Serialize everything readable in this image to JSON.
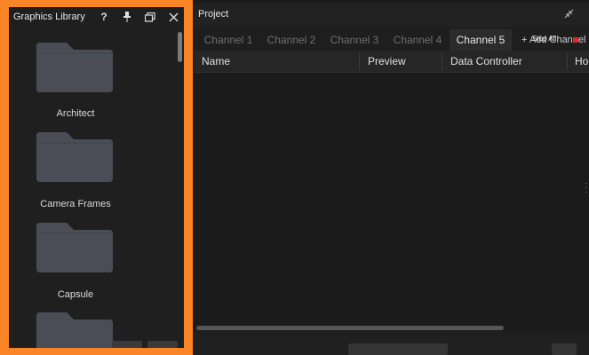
{
  "graphics_library": {
    "title": "Graphics Library",
    "icons": [
      "help-icon",
      "pin-icon",
      "restore-window-icon",
      "close-icon"
    ],
    "help_glyph": "?",
    "folders": [
      {
        "label": "Architect"
      },
      {
        "label": "Camera Frames"
      },
      {
        "label": "Capsule"
      },
      {
        "label": ""
      }
    ]
  },
  "project": {
    "title": "Project",
    "tabs": [
      {
        "label": "Channel 1",
        "active": false
      },
      {
        "label": "Channel 2",
        "active": false
      },
      {
        "label": "Channel 3",
        "active": false
      },
      {
        "label": "Channel 4",
        "active": false
      },
      {
        "label": "Channel 5",
        "active": true
      }
    ],
    "add_channel_label": "+ Add Channel",
    "stop_all_label": "Stop All",
    "columns": [
      "Name",
      "Preview",
      "Data Controller",
      "Ho"
    ]
  },
  "colors": {
    "highlight_border": "#fa8526",
    "stop_indicator": "#e0242a",
    "folder": "#4a4d55"
  }
}
